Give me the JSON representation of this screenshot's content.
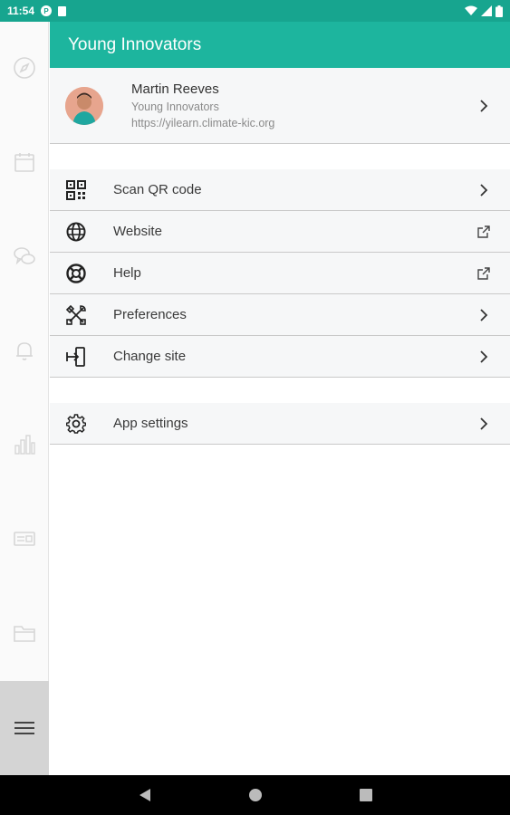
{
  "status_bar": {
    "time": "11:54"
  },
  "app": {
    "title": "Young Innovators"
  },
  "profile": {
    "name": "Martin Reeves",
    "site": "Young Innovators",
    "url": "https://yilearn.climate-kic.org"
  },
  "menu": [
    {
      "label": "Scan QR code",
      "icon": "qr-code-icon",
      "trail": "chevron-right-icon"
    },
    {
      "label": "Website",
      "icon": "globe-icon",
      "trail": "external-link-icon"
    },
    {
      "label": "Help",
      "icon": "lifebuoy-icon",
      "trail": "external-link-icon"
    },
    {
      "label": "Preferences",
      "icon": "wrench-screwdriver-icon",
      "trail": "chevron-right-icon"
    },
    {
      "label": "Change site",
      "icon": "change-site-icon",
      "trail": "chevron-right-icon"
    }
  ],
  "settings": {
    "label": "App settings",
    "icon": "gear-icon",
    "trail": "chevron-right-icon"
  },
  "rail_items": [
    "compass-icon",
    "calendar-icon",
    "chat-bubbles-icon",
    "bell-icon",
    "bar-chart-icon",
    "card-icon",
    "folder-icon",
    "hamburger-menu-icon"
  ],
  "colors": {
    "header": "#1db59e",
    "status_bar": "#17a58f",
    "rail_active": "#d4d4d4"
  }
}
